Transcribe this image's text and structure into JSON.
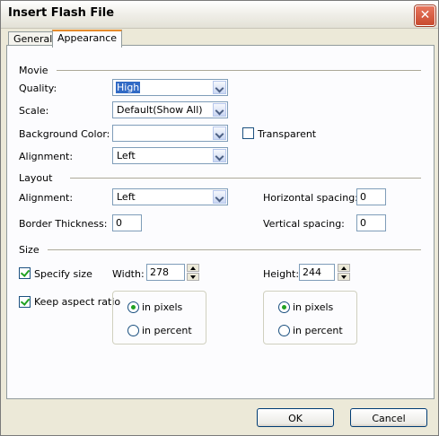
{
  "dialog": {
    "title": "Insert Flash File"
  },
  "tabs": [
    {
      "label": "General"
    },
    {
      "label": "Appearance"
    }
  ],
  "movie": {
    "section": "Movie",
    "quality_label": "Quality:",
    "quality_value": "High",
    "scale_label": "Scale:",
    "scale_value": "Default(Show All)",
    "bgcolor_label": "Background Color:",
    "bgcolor_value": "",
    "transparent_label": "Transparent",
    "transparent_checked": false,
    "alignment_label": "Alignment:",
    "alignment_value": "Left"
  },
  "layout": {
    "section": "Layout",
    "alignment_label": "Alignment:",
    "alignment_value": "Left",
    "border_label": "Border Thickness:",
    "border_value": "0",
    "hspacing_label": "Horizontal spacing:",
    "hspacing_value": "0",
    "vspacing_label": "Vertical spacing:",
    "vspacing_value": "0"
  },
  "size": {
    "section": "Size",
    "specify_label": "Specify size",
    "specify_checked": true,
    "keep_aspect_label": "Keep aspect ratio",
    "keep_aspect_checked": true,
    "width_label": "Width:",
    "width_value": "278",
    "height_label": "Height:",
    "height_value": "244",
    "width_units": {
      "pixels": "in pixels",
      "percent": "in percent",
      "selected": "pixels"
    },
    "height_units": {
      "pixels": "in pixels",
      "percent": "in percent",
      "selected": "pixels"
    }
  },
  "buttons": {
    "ok": "OK",
    "cancel": "Cancel"
  },
  "colors": {
    "accent": "#316ac5",
    "check": "#21a121",
    "tab_highlight": "#e68b2c",
    "close": "#c84a2e"
  },
  "icons": {
    "close": "close-icon"
  }
}
